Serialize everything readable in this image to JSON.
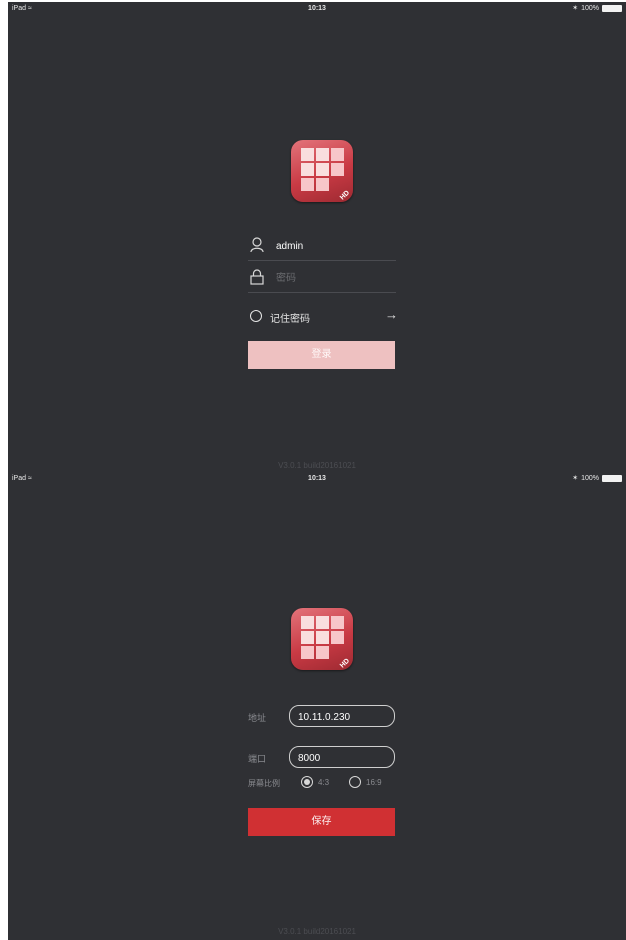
{
  "status_bar": {
    "device": "iPad",
    "time": "10:13",
    "battery": "100%"
  },
  "login_screen": {
    "username_value": "admin",
    "password_placeholder": "密码",
    "remember_label": "记住密码",
    "login_button": "登录",
    "version": "V3.0.1 build20161021"
  },
  "settings_screen": {
    "address_label": "地址",
    "address_value": "10.11.0.230",
    "port_label": "端口",
    "port_value": "8000",
    "ratio_label": "屏幕比例",
    "ratio_options": [
      "4:3",
      "16:9"
    ],
    "ratio_selected": "4:3",
    "save_button": "保存",
    "version": "V3.0.1 build20161021"
  },
  "icons": {
    "app": "grid-app-icon",
    "badge": "HD",
    "user": "user-icon",
    "lock": "lock-icon",
    "arrow": "arrow-right-icon",
    "wifi": "wifi-icon",
    "bluetooth": "bluetooth-icon"
  },
  "colors": {
    "background": "#2f3034",
    "accent": "#d03033",
    "accent_disabled": "#eec1c1"
  }
}
